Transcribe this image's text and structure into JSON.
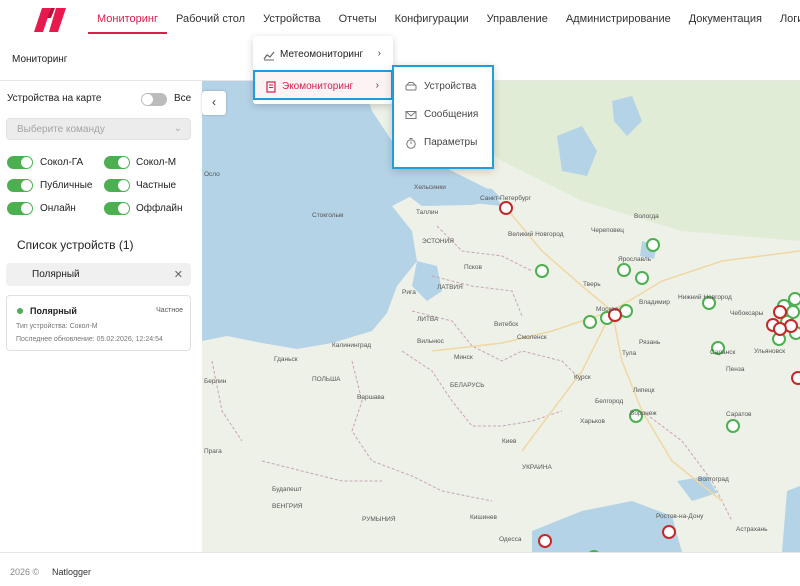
{
  "nav": {
    "items": [
      "Мониторинг",
      "Рабочий стол",
      "Устройства",
      "Отчеты",
      "Конфигурации",
      "Управление",
      "Администрирование",
      "Документация",
      "Логи"
    ],
    "active_index": 0,
    "accent_color": "#d5204c"
  },
  "page": {
    "title": "Мониторинг"
  },
  "sidebar": {
    "devices_on_map_label": "Устройства на карте",
    "all_label": "Все",
    "command_placeholder": "Выберите команду",
    "filters": [
      {
        "label": "Сокол-ГА",
        "on": true
      },
      {
        "label": "Сокол-М",
        "on": true
      },
      {
        "label": "Публичные",
        "on": true
      },
      {
        "label": "Частные",
        "on": true
      },
      {
        "label": "Онлайн",
        "on": true
      },
      {
        "label": "Оффлайн",
        "on": true
      }
    ],
    "device_list_title": "Список устройств (1)",
    "search_value": "Полярный",
    "device_card": {
      "name": "Полярный",
      "kind": "Частное",
      "type_line": "Тип устройства: Сокол-М",
      "updated_line": "Последнее обновление: 05.02.2026, 12:24:54",
      "status_color": "#4caf50"
    }
  },
  "menu": {
    "level1": [
      {
        "label": "Метеомониторинг",
        "icon": "chart-line-icon"
      },
      {
        "label": "Экомониторинг",
        "icon": "document-icon",
        "selected": true
      }
    ],
    "level2": [
      {
        "label": "Устройства",
        "icon": "drive-icon"
      },
      {
        "label": "Сообщения",
        "icon": "envelope-icon"
      },
      {
        "label": "Параметры",
        "icon": "stopwatch-icon"
      }
    ]
  },
  "map": {
    "labels": {
      "helsinki": "Хельсинки",
      "tallinn": "Таллин",
      "stockholm": "Стокгольм",
      "spb": "Санкт-Петербург",
      "vnovgorod": "Великий Новгород",
      "riga": "Рига",
      "estonia": "ЭСТОНИЯ",
      "latvia": "ЛАТВИЯ",
      "lithuania": "ЛИТВА",
      "vilnius": "Вильнюс",
      "minsk": "Минск",
      "belarus": "БЕЛАРУСЬ",
      "kaliningrad": "Калининград",
      "warsaw": "Варшава",
      "poland": "ПОЛЬША",
      "berlin": "Берлин",
      "moscow": "Москва",
      "smolensk": "Смоленск",
      "vitebsk": "Витебск",
      "kyiv": "Киев",
      "ukraine": "УКРАИНА",
      "kishinev": "Кишинев",
      "odessa": "Одесса",
      "vologda": "Вологда",
      "yaroslavl": "Ярославль",
      "tver": "Тверь",
      "vladimir": "Владимир",
      "ryazan": "Рязань",
      "tula": "Тула",
      "voronezh": "Воронеж",
      "kursk": "Курск",
      "saratov": "Саратов",
      "volgograd": "Волгоград",
      "rostov": "Ростов-на-Дону",
      "astrakhan": "Астрахань",
      "nnovgorod": "Нижний Новгород",
      "cheboksary": "Чебоксары",
      "saransk": "Саранск",
      "ulyanovsk": "Ульяновск",
      "lipetsk": "Липецк",
      "penza": "Пенза",
      "cherepovets": "Череповец",
      "belgorod": "Белгород",
      "kharkiv": "Харьков",
      "budapest": "Будапешт",
      "hungary": "ВЕНГРИЯ",
      "romania": "РУМЫНИЯ",
      "pskov": "Псков",
      "gdansk": "Гданьск",
      "oslo": "Осло",
      "prague": "Прага"
    },
    "online_color": "#4caf50",
    "offline_color": "#c62828"
  },
  "footer": {
    "copyright": "2026 ©",
    "brand": "Natlogger"
  }
}
